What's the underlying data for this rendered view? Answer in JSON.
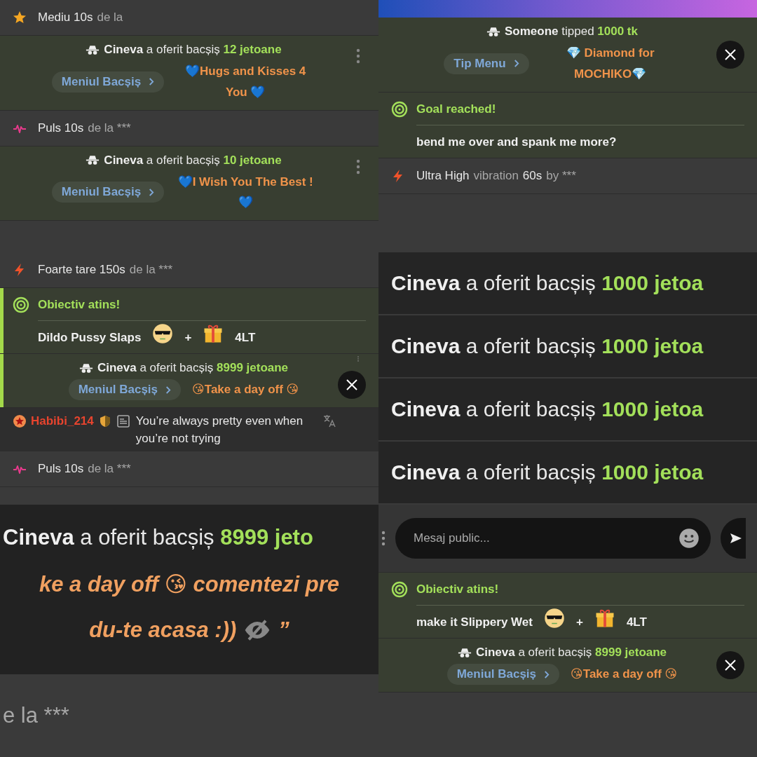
{
  "panels": [
    {
      "rows": [
        {
          "kind": "star_event",
          "parts": [
            {
              "text": "Mediu 10s",
              "muted": false
            },
            {
              "text": "de la",
              "muted": true
            }
          ]
        },
        {
          "kind": "tip",
          "sender": "Cineva",
          "verb": "a oferit bacșiș",
          "amount": "12 jetoane",
          "menu": "Meniul Bacșiș",
          "item": "💙Hugs and Kisses 4 You 💙",
          "more": true,
          "close": false,
          "accent": false
        },
        {
          "kind": "pulse_event",
          "parts": [
            {
              "text": "Puls 10s",
              "muted": false
            },
            {
              "text": "de la ***",
              "muted": true
            }
          ]
        },
        {
          "kind": "tip",
          "sender": "Cineva",
          "verb": "a oferit bacșiș",
          "amount": "10 jetoane",
          "menu": "Meniul Bacșiș",
          "item": "💙I Wish You The Best ! 💙",
          "more": true,
          "close": false,
          "accent": false
        }
      ]
    },
    {
      "rows": [
        {
          "kind": "banner"
        },
        {
          "kind": "tip",
          "sender": "Someone",
          "verb": "tipped",
          "amount": "1000 tk",
          "menu": "Tip Menu",
          "item": "💎 Diamond for MOCHIKO💎",
          "more": false,
          "close": true,
          "accent": false
        },
        {
          "kind": "goal",
          "title": "Goal reached!",
          "text": "bend me over and spank me more?",
          "accent": false
        },
        {
          "kind": "bolt_event",
          "parts": [
            {
              "text": "Ultra High",
              "muted": false
            },
            {
              "text": "vibration",
              "muted": true
            },
            {
              "text": "60s",
              "muted": false
            },
            {
              "text": "by ***",
              "muted": true
            }
          ]
        }
      ]
    },
    {
      "rows": [
        {
          "kind": "bolt_event",
          "parts": [
            {
              "text": "Foarte tare 150s",
              "muted": false
            },
            {
              "text": "de la ***",
              "muted": true
            }
          ]
        },
        {
          "kind": "goal",
          "title": "Obiectiv atins!",
          "text": "Dildo Pussy Slaps",
          "plus": "+",
          "reward": "4LT",
          "accent": true
        },
        {
          "kind": "tip",
          "sender": "Cineva",
          "verb": "a oferit bacșiș",
          "amount": "8999 jetoane",
          "menu": "Meniul Bacșiș",
          "item": "😘Take a day off 😘",
          "more": true,
          "close": true,
          "accent": true
        },
        {
          "kind": "chat",
          "user": "Habibi_214",
          "message": "You’re always pretty even when you’re not trying"
        },
        {
          "kind": "pulse_event",
          "parts": [
            {
              "text": "Puls 10s",
              "muted": false
            },
            {
              "text": "de la ***",
              "muted": true
            }
          ]
        }
      ]
    },
    {
      "rows": [
        {
          "kind": "big_tip",
          "sender": "Cineva",
          "verb": "a oferit bacșiș",
          "amount": "1000 jetoa"
        },
        {
          "kind": "big_tip",
          "sender": "Cineva",
          "verb": "a oferit bacșiș",
          "amount": "1000 jetoa"
        },
        {
          "kind": "big_tip",
          "sender": "Cineva",
          "verb": "a oferit bacșiș",
          "amount": "1000 jetoa"
        },
        {
          "kind": "big_tip",
          "sender": "Cineva",
          "verb": "a oferit bacșiș",
          "amount": "1000 jetoa"
        }
      ]
    },
    {
      "rows": [
        {
          "kind": "zoom_tip",
          "sender": "Cineva",
          "verb": "a oferit bacșiș",
          "amount": "8999 jeto"
        },
        {
          "kind": "zoom_note",
          "text": "ke a day off 😘 comentezi pre",
          "hidden": false
        },
        {
          "kind": "zoom_note",
          "text": "du-te acasa :))",
          "hidden": true,
          "tail": "”"
        },
        {
          "kind": "zoom_event",
          "text": "e la ***"
        }
      ]
    },
    {
      "rows": [
        {
          "kind": "input",
          "placeholder": "Mesaj public..."
        },
        {
          "kind": "goal",
          "title": "Obiectiv atins!",
          "text": "make it Slippery Wet",
          "plus": "+",
          "reward": "4LT",
          "accent": false
        },
        {
          "kind": "tip",
          "sender": "Cineva",
          "verb": "a oferit bacșiș",
          "amount": "8999 jetoane",
          "menu": "Meniul Bacșiș",
          "item": "😘Take a day off 😘",
          "more": false,
          "close": true,
          "accent": false
        }
      ]
    }
  ]
}
